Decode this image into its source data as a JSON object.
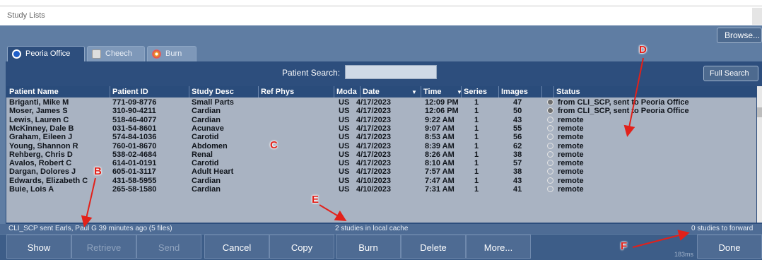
{
  "window": {
    "title": "Study Lists"
  },
  "toolbar": {
    "browse_label": "Browse..."
  },
  "tabs": [
    {
      "label": "Peoria Office",
      "icon": "site-icon",
      "active": true
    },
    {
      "label": "Cheech",
      "icon": "server-icon",
      "active": false
    },
    {
      "label": "Burn",
      "icon": "disc-icon",
      "active": false
    }
  ],
  "search": {
    "label": "Patient Search:",
    "value": "",
    "full_search_label": "Full Search"
  },
  "table": {
    "columns": [
      "Patient Name",
      "Patient ID",
      "Study Desc",
      "Ref Phys",
      "Moda",
      "Date",
      "Time",
      "Series",
      "Images",
      "Status"
    ],
    "date_sort_icon": "sort-down-icon",
    "time_sort_icon": "sort-down-icon",
    "rows": [
      {
        "name": "Briganti, Mike M",
        "id": "771-09-8776",
        "desc": "Small Parts",
        "ref": "",
        "mod": "US",
        "date": "4/17/2023",
        "time": "12:09 PM",
        "series": "1",
        "images": "47",
        "status_icon": "downloaded-icon",
        "status": "from CLI_SCP, sent to Peoria Office"
      },
      {
        "name": "Moser, James S",
        "id": "310-90-4211",
        "desc": "Cardian",
        "ref": "",
        "mod": "US",
        "date": "4/17/2023",
        "time": "12:06 PM",
        "series": "1",
        "images": "50",
        "status_icon": "downloaded-icon",
        "status": "from CLI_SCP, sent to Peoria Office"
      },
      {
        "name": "Lewis, Lauren C",
        "id": "518-46-4077",
        "desc": "Cardian",
        "ref": "",
        "mod": "US",
        "date": "4/17/2023",
        "time": "9:22 AM",
        "series": "1",
        "images": "43",
        "status_icon": "remote-icon",
        "status": "remote"
      },
      {
        "name": "McKinney, Dale B",
        "id": "031-54-8601",
        "desc": "Acunave",
        "ref": "",
        "mod": "US",
        "date": "4/17/2023",
        "time": "9:07 AM",
        "series": "1",
        "images": "55",
        "status_icon": "remote-icon",
        "status": "remote"
      },
      {
        "name": "Graham, Eileen J",
        "id": "574-84-1036",
        "desc": "Carotid",
        "ref": "",
        "mod": "US",
        "date": "4/17/2023",
        "time": "8:53 AM",
        "series": "1",
        "images": "56",
        "status_icon": "remote-icon",
        "status": "remote"
      },
      {
        "name": "Young, Shannon R",
        "id": "760-01-8670",
        "desc": "Abdomen",
        "ref": "",
        "mod": "US",
        "date": "4/17/2023",
        "time": "8:39 AM",
        "series": "1",
        "images": "62",
        "status_icon": "remote-icon",
        "status": "remote"
      },
      {
        "name": "Rehberg, Chris D",
        "id": "538-02-4684",
        "desc": "Renal",
        "ref": "",
        "mod": "US",
        "date": "4/17/2023",
        "time": "8:26 AM",
        "series": "1",
        "images": "38",
        "status_icon": "remote-icon",
        "status": "remote"
      },
      {
        "name": "Avalos, Robert C",
        "id": "614-01-0191",
        "desc": "Carotid",
        "ref": "",
        "mod": "US",
        "date": "4/17/2023",
        "time": "8:10 AM",
        "series": "1",
        "images": "57",
        "status_icon": "remote-icon",
        "status": "remote"
      },
      {
        "name": "Dargan, Dolores J",
        "id": "605-01-3117",
        "desc": "Adult Heart",
        "ref": "",
        "mod": "US",
        "date": "4/17/2023",
        "time": "7:57 AM",
        "series": "1",
        "images": "38",
        "status_icon": "remote-icon",
        "status": "remote"
      },
      {
        "name": "Edwards, Elizabeth C",
        "id": "431-58-5955",
        "desc": "Cardian",
        "ref": "",
        "mod": "US",
        "date": "4/10/2023",
        "time": "7:47 AM",
        "series": "1",
        "images": "43",
        "status_icon": "remote-icon",
        "status": "remote"
      },
      {
        "name": "Buie, Lois A",
        "id": "265-58-1580",
        "desc": "Cardian",
        "ref": "",
        "mod": "US",
        "date": "4/10/2023",
        "time": "7:31 AM",
        "series": "1",
        "images": "41",
        "status_icon": "remote-icon",
        "status": "remote"
      }
    ]
  },
  "status_bar": {
    "left": "CLI_SCP sent Earls, Paul G 39 minutes ago (5 files)",
    "center": "2 studies in local cache",
    "right": "0 studies to forward"
  },
  "buttons": {
    "show": "Show",
    "retrieve": "Retrieve",
    "send": "Send",
    "cancel": "Cancel",
    "copy": "Copy",
    "burn": "Burn",
    "delete": "Delete",
    "more": "More...",
    "done": "Done"
  },
  "latency": "183ms",
  "annotations": {
    "b": "B",
    "c": "C",
    "d": "D",
    "e": "E",
    "f": "F"
  },
  "colors": {
    "annotation": "#e2211a",
    "panel": "#2d4e7d",
    "grid_bg": "#a9b3c2"
  }
}
